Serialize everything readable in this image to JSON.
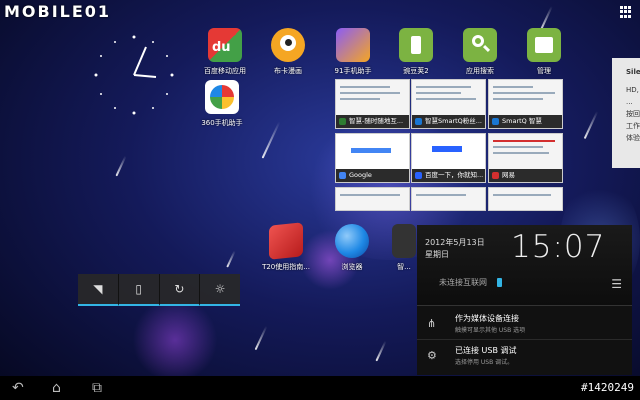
{
  "watermark": "MOBILE01",
  "apps": [
    {
      "label": "百度移动应用",
      "icon": "baidu-app-icon",
      "color": "#4a90e2"
    },
    {
      "label": "布卡漫画",
      "icon": "buka-comic-icon",
      "color": "#f5a623"
    },
    {
      "label": "91手机助手",
      "icon": "91-assistant-icon",
      "color": "#8b5cf6"
    },
    {
      "label": "豌豆荚2",
      "icon": "wandoujia-icon",
      "color": "#7cb342"
    },
    {
      "label": "应用搜索",
      "icon": "app-search-icon",
      "color": "#7cb342"
    },
    {
      "label": "管理",
      "icon": "manager-icon",
      "color": "#7cb342"
    },
    {
      "label": "360手机助手",
      "icon": "360-assistant-icon",
      "color": "#e53935"
    },
    {
      "label": "T20使用指南...",
      "icon": "t20-guide-icon",
      "color": "#e53935"
    },
    {
      "label": "浏览器",
      "icon": "browser-globe-icon",
      "color": "#1e88e5"
    },
    {
      "label": "智...",
      "icon": "smartq-icon",
      "color": "#333333"
    }
  ],
  "thumbs": [
    {
      "caption": "智慧-随时随地互...",
      "fav": "#2e7d32"
    },
    {
      "caption": "智慧SmartQ粉丝...",
      "fav": "#1976d2"
    },
    {
      "caption": "SmartQ 智慧",
      "fav": "#1976d2"
    },
    {
      "caption": "Google",
      "fav": "#4285f4"
    },
    {
      "caption": "百度一下，你就知...",
      "fav": "#2962ff"
    },
    {
      "caption": "网易",
      "fav": "#d32f2f"
    }
  ],
  "quick_settings": [
    "wifi-icon",
    "vibrate-icon",
    "sync-icon",
    "brightness-icon"
  ],
  "notifications": {
    "date": "2012年5月13日",
    "weekday": "星期日",
    "time": "15:07",
    "network": "未连接互联网",
    "items": [
      {
        "title": "作为媒体设备连接",
        "sub": "触摸可显示其他 USB 选项",
        "icon": "usb-icon"
      },
      {
        "title": "已连接 USB 调试",
        "sub": "选择停用 USB 调试。",
        "icon": "android-debug-icon"
      }
    ]
  },
  "edge_widget": {
    "title": "Siler",
    "lines": [
      "HD,",
      "...",
      "按回",
      "工作",
      "体验"
    ]
  },
  "tag": "#1420249",
  "colors": {
    "accent": "#33b5e5",
    "panel": "#111111"
  }
}
